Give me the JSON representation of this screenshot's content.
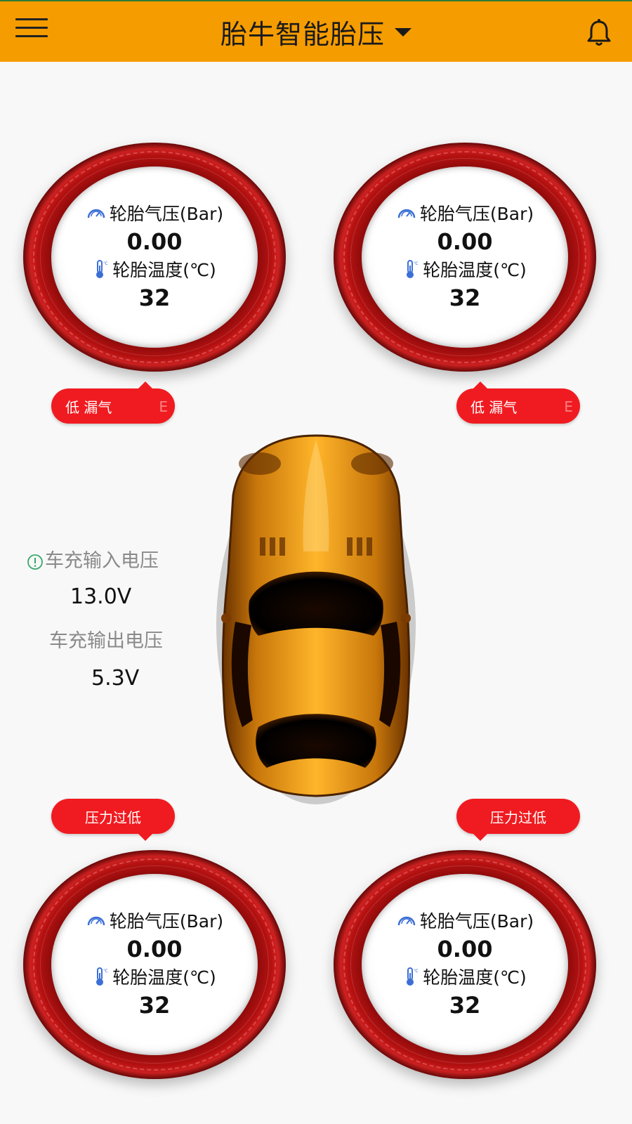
{
  "app_bar": {
    "title": "胎牛智能胎压",
    "background": "#f59c00",
    "icons": {
      "menu": "menu-icon",
      "dropdown": "caret-down-icon",
      "notifications": "bell-icon"
    }
  },
  "tires": {
    "front_left": {
      "pressure_label": "轮胎气压(Bar)",
      "pressure": "0.00",
      "temp_label": "轮胎温度(℃)",
      "temp": "32"
    },
    "front_right": {
      "pressure_label": "轮胎气压(Bar)",
      "pressure": "0.00",
      "temp_label": "轮胎温度(℃)",
      "temp": "32"
    },
    "rear_left": {
      "pressure_label": "轮胎气压(Bar)",
      "pressure": "0.00",
      "temp_label": "轮胎温度(℃)",
      "temp": "32"
    },
    "rear_right": {
      "pressure_label": "轮胎气压(Bar)",
      "pressure": "0.00",
      "temp_label": "轮胎温度(℃)",
      "temp": "32"
    }
  },
  "alerts": {
    "front_left": {
      "text": "低 漏气",
      "ghost": "E"
    },
    "front_right": {
      "text": "低 漏气",
      "ghost": "E"
    },
    "rear_left": {
      "text": "压力过低"
    },
    "rear_right": {
      "text": "压力过低"
    },
    "color": "#f01b20"
  },
  "charger": {
    "input_label": "车充输入电压",
    "input_value": "13.0V",
    "output_label": "车充输出电压",
    "output_value": "5.3V"
  }
}
